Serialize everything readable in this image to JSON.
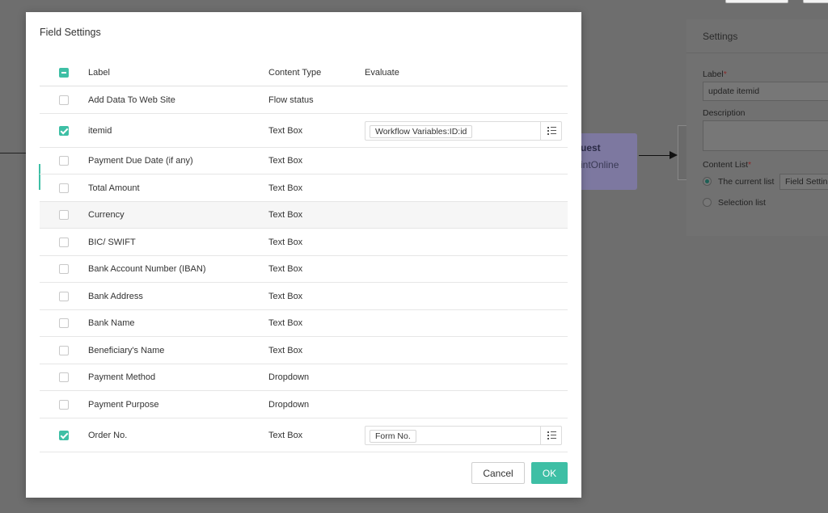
{
  "background": {
    "node": {
      "title": "uest",
      "subtitle": "intOnline"
    },
    "settings_panel": {
      "title": "Settings",
      "label_field": {
        "label": "Label",
        "required_mark": "*",
        "value": "update itemid"
      },
      "description_field": {
        "label": "Description",
        "value": ""
      },
      "content_list": {
        "label": "Content List",
        "required_mark": "*",
        "options": [
          {
            "label": "The current list",
            "selected": true
          },
          {
            "label": "Selection list",
            "selected": false
          }
        ],
        "current_list_value": "Field Settin"
      }
    }
  },
  "modal": {
    "title": "Field Settings",
    "columns": {
      "label": "Label",
      "content_type": "Content Type",
      "evaluate": "Evaluate"
    },
    "rows": [
      {
        "label": "Add Data To Web Site",
        "content_type": "Flow status",
        "checked": false,
        "evaluate": ""
      },
      {
        "label": "itemid",
        "content_type": "Text Box",
        "checked": true,
        "evaluate": "Workflow Variables:ID:id"
      },
      {
        "label": "Payment Due Date (if any)",
        "content_type": "Text Box",
        "checked": false,
        "evaluate": ""
      },
      {
        "label": "Total Amount",
        "content_type": "Text Box",
        "checked": false,
        "evaluate": ""
      },
      {
        "label": "Currency",
        "content_type": "Text Box",
        "checked": false,
        "evaluate": ""
      },
      {
        "label": "BIC/ SWIFT",
        "content_type": "Text Box",
        "checked": false,
        "evaluate": ""
      },
      {
        "label": "Bank Account Number (IBAN)",
        "content_type": "Text Box",
        "checked": false,
        "evaluate": ""
      },
      {
        "label": "Bank Address",
        "content_type": "Text Box",
        "checked": false,
        "evaluate": ""
      },
      {
        "label": "Bank Name",
        "content_type": "Text Box",
        "checked": false,
        "evaluate": ""
      },
      {
        "label": "Beneficiary's Name",
        "content_type": "Text Box",
        "checked": false,
        "evaluate": ""
      },
      {
        "label": "Payment Method",
        "content_type": "Dropdown",
        "checked": false,
        "evaluate": ""
      },
      {
        "label": "Payment Purpose",
        "content_type": "Dropdown",
        "checked": false,
        "evaluate": ""
      },
      {
        "label": "Order No.",
        "content_type": "Text Box",
        "checked": true,
        "evaluate": "Form No."
      }
    ],
    "buttons": {
      "cancel": "Cancel",
      "ok": "OK"
    }
  },
  "colors": {
    "accent": "#3ebfa5",
    "overlay": "#6e6e6e",
    "node": "#7d78a0"
  }
}
